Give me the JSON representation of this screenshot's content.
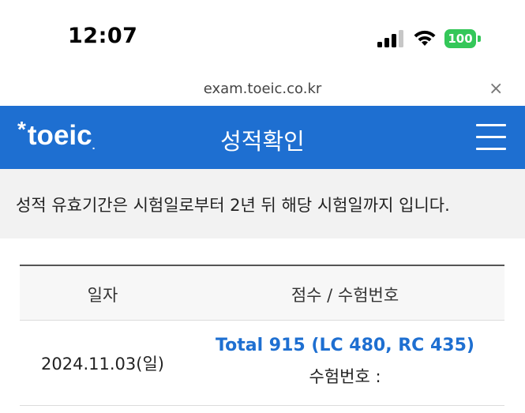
{
  "status_bar": {
    "time": "12:07",
    "battery": "100"
  },
  "browser": {
    "url": "exam.toeic.co.kr",
    "close_symbol": "×"
  },
  "header": {
    "logo_star": "*",
    "logo": "toeic",
    "logo_dot": ".",
    "title": "성적확인",
    "menu_icon": "hamburger-menu-icon"
  },
  "notice": {
    "text": "성적 유효기간은 시험일로부터 2년 뒤 해당 시험일까지 입니다."
  },
  "table": {
    "columns": [
      "일자",
      "점수 / 수험번호"
    ],
    "rows": [
      {
        "date": "2024.11.03(일)",
        "score": "Total 915 (LC 480, RC 435)",
        "exam_number": "수험번호 :"
      }
    ]
  },
  "colors": {
    "brand_blue": "#1e6fd1",
    "battery_green": "#34c759",
    "notice_bg": "#f2f2f2"
  }
}
